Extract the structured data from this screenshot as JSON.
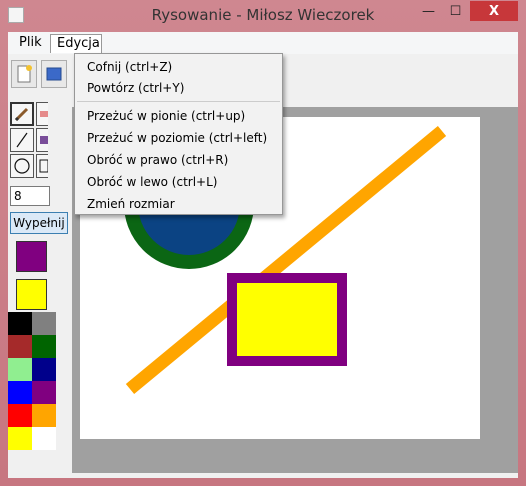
{
  "window": {
    "title": "Rysowanie - Miłosz Wieczorek",
    "minimize_label": "—",
    "maximize_label": "☐",
    "close_label": "X"
  },
  "menubar": {
    "items": [
      "Plik",
      "Edycja"
    ],
    "open_menu": "Edycja"
  },
  "edycja_menu": {
    "items": [
      "Cofnij (ctrl+Z)",
      "Powtórz (ctrl+Y)",
      "Przeżuć w pionie (ctrl+up)",
      "Przeżuć w poziomie (ctrl+left)",
      "Obróć w prawo (ctrl+R)",
      "Obróć w lewo (ctrl+L)",
      "Zmień rozmiar"
    ]
  },
  "tools": {
    "size_value": "8",
    "fill_label": "Wypełnij",
    "primary_color": "#800080",
    "secondary_color": "#ffff00",
    "icons": [
      "pencil-icon",
      "eraser-icon",
      "line-icon",
      "brush-icon",
      "ellipse-icon",
      "rectangle-icon"
    ]
  },
  "palette": {
    "colors": [
      "#000000",
      "#808080",
      "#a52a2a",
      "#006400",
      "#90ee90",
      "#00008b",
      "#0000ff",
      "#800080",
      "#ff0000",
      "#ffa500",
      "#ffff00",
      "#ffffff"
    ]
  },
  "drawing": {
    "circle": {
      "fill": "#0b4383",
      "stroke": "#0b6614"
    },
    "line": {
      "color": "#ffa500"
    },
    "rectangle": {
      "fill": "#ffff00",
      "stroke": "#800080"
    }
  }
}
